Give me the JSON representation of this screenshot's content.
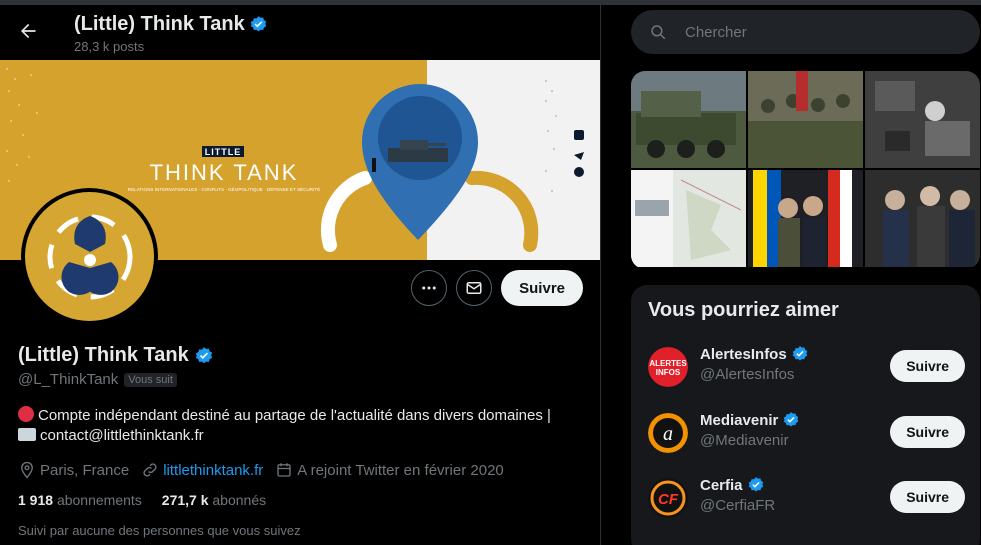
{
  "header": {
    "name": "(Little) Think Tank",
    "posts": "28,3 k posts"
  },
  "banner": {
    "small_label": "LITTLE",
    "big_label": "THINK TANK",
    "tagline": "RELATIONS INTERNATIONALES · CONFLITS · GÉOPOLITIQUE · DÉFENSE ET SÉCURITÉ"
  },
  "profile": {
    "name": "(Little) Think Tank",
    "handle": "@L_ThinkTank",
    "follows_you": "Vous suit",
    "bio_line1": "Compte indépendant destiné au partage de l'actualité dans divers domaines |",
    "bio_line2": "contact@littlethinktank.fr",
    "location": "Paris, France",
    "website": "littlethinktank.fr",
    "joined": "A rejoint Twitter en février 2020",
    "following_count": "1 918",
    "following_label": "abonnements",
    "followers_count": "271,7 k",
    "followers_label": "abonnés",
    "followed_by": "Suivi par aucune des personnes que vous suivez",
    "follow_label": "Suivre"
  },
  "search": {
    "placeholder": "Chercher"
  },
  "who_to_follow": {
    "title": "Vous pourriez aimer",
    "items": [
      {
        "name": "AlertesInfos",
        "handle": "@AlertesInfos",
        "follow": "Suivre",
        "logo_text_1": "ALERTES",
        "logo_text_2": "INFOS"
      },
      {
        "name": "Mediavenir",
        "handle": "@Mediavenir",
        "follow": "Suivre",
        "logo_text_1": "a"
      },
      {
        "name": "Cerfia",
        "handle": "@CerfiaFR",
        "follow": "Suivre",
        "logo_text_1": "CF"
      }
    ]
  },
  "colors": {
    "accent": "#1d9bf0",
    "brand_gold": "#d5a632",
    "navy": "#1e3a6e"
  },
  "icons": [
    "back-arrow-icon",
    "verified-icon",
    "more-icon",
    "mail-icon",
    "search-icon",
    "location-icon",
    "link-icon",
    "calendar-icon"
  ]
}
